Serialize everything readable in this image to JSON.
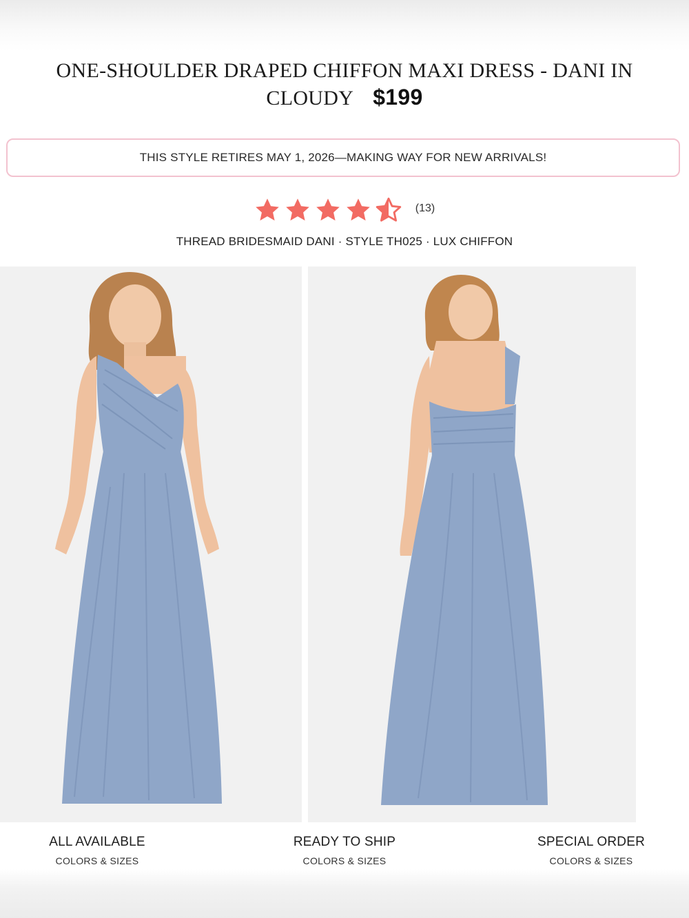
{
  "product": {
    "title": "ONE-SHOULDER DRAPED CHIFFON MAXI DRESS - DANI IN CLOUDY",
    "price": "$199",
    "notice": "THIS STYLE RETIRES MAY 1, 2026—MAKING WAY FOR NEW ARRIVALS!",
    "rating": {
      "stars": 4.5,
      "max": 5,
      "count_label": "(13)",
      "color": "#f26b63"
    },
    "meta": "THREAD BRIDESMAID DANI · STYLE TH025 · LUX CHIFFON",
    "dress_color": "#8fa6c8"
  },
  "options": [
    {
      "label": "ALL AVAILABLE",
      "sub": "COLORS & SIZES"
    },
    {
      "label": "READY TO SHIP",
      "sub": "COLORS & SIZES"
    },
    {
      "label": "SPECIAL ORDER",
      "sub": "COLORS & SIZES"
    }
  ]
}
